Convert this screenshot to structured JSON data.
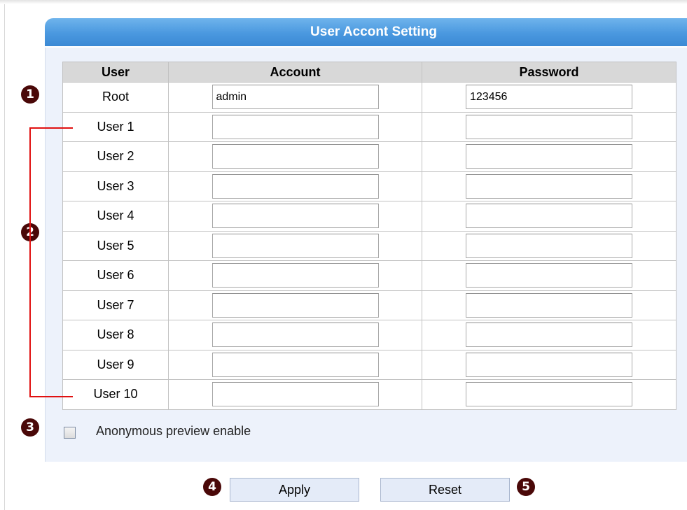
{
  "title": "User Accont Setting",
  "table": {
    "headers": [
      "User",
      "Account",
      "Password"
    ],
    "rows": [
      {
        "user": "Root",
        "account": "admin",
        "password": "123456"
      },
      {
        "user": "User 1",
        "account": "",
        "password": ""
      },
      {
        "user": "User 2",
        "account": "",
        "password": ""
      },
      {
        "user": "User 3",
        "account": "",
        "password": ""
      },
      {
        "user": "User 4",
        "account": "",
        "password": ""
      },
      {
        "user": "User 5",
        "account": "",
        "password": ""
      },
      {
        "user": "User 6",
        "account": "",
        "password": ""
      },
      {
        "user": "User 7",
        "account": "",
        "password": ""
      },
      {
        "user": "User 8",
        "account": "",
        "password": ""
      },
      {
        "user": "User 9",
        "account": "",
        "password": ""
      },
      {
        "user": "User 10",
        "account": "",
        "password": ""
      }
    ]
  },
  "anonymous": {
    "label": "Anonymous preview enable",
    "checked": false
  },
  "buttons": {
    "apply": "Apply",
    "reset": "Reset"
  },
  "markers": [
    "1",
    "2",
    "3",
    "4",
    "5"
  ],
  "colors": {
    "title_bar": "#4a98df",
    "panel_bg": "#edf2fb",
    "marker": "#4a0808",
    "bracket": "#e01010",
    "button_bg": "#e4ebf8"
  }
}
